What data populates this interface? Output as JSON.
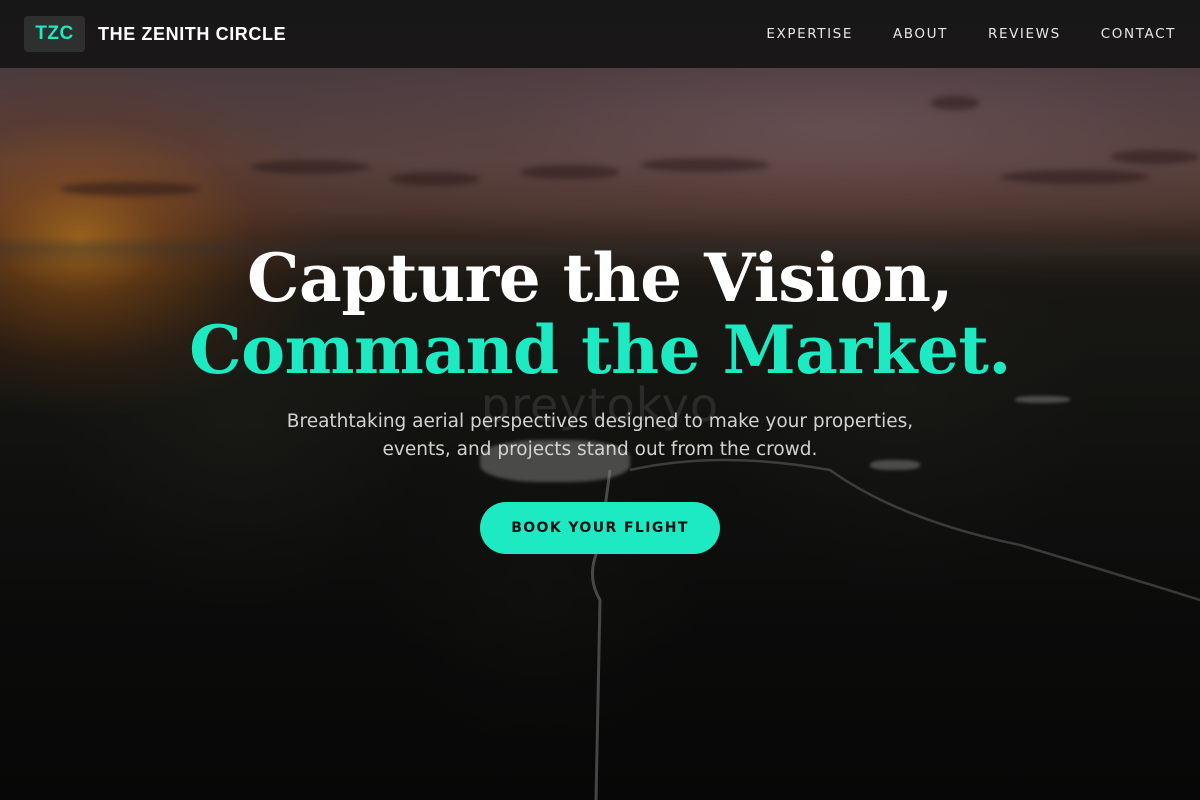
{
  "header": {
    "logo_text": "TZC",
    "brand_name": "THE ZENITH CIRCLE",
    "nav": [
      {
        "label": "EXPERTISE"
      },
      {
        "label": "ABOUT"
      },
      {
        "label": "REVIEWS"
      },
      {
        "label": "CONTACT"
      }
    ]
  },
  "hero": {
    "headline_line1": "Capture the Vision,",
    "headline_line2": "Command the Market.",
    "subtext": "Breathtaking aerial perspectives designed to make your properties, events, and projects stand out from the crowd.",
    "cta_label": "BOOK YOUR FLIGHT",
    "background_watermark": "preytokyo"
  },
  "colors": {
    "accent": "#1de9c2",
    "header_bg": "#161414",
    "text_primary": "#ffffff",
    "text_muted": "#d2d2d2"
  }
}
